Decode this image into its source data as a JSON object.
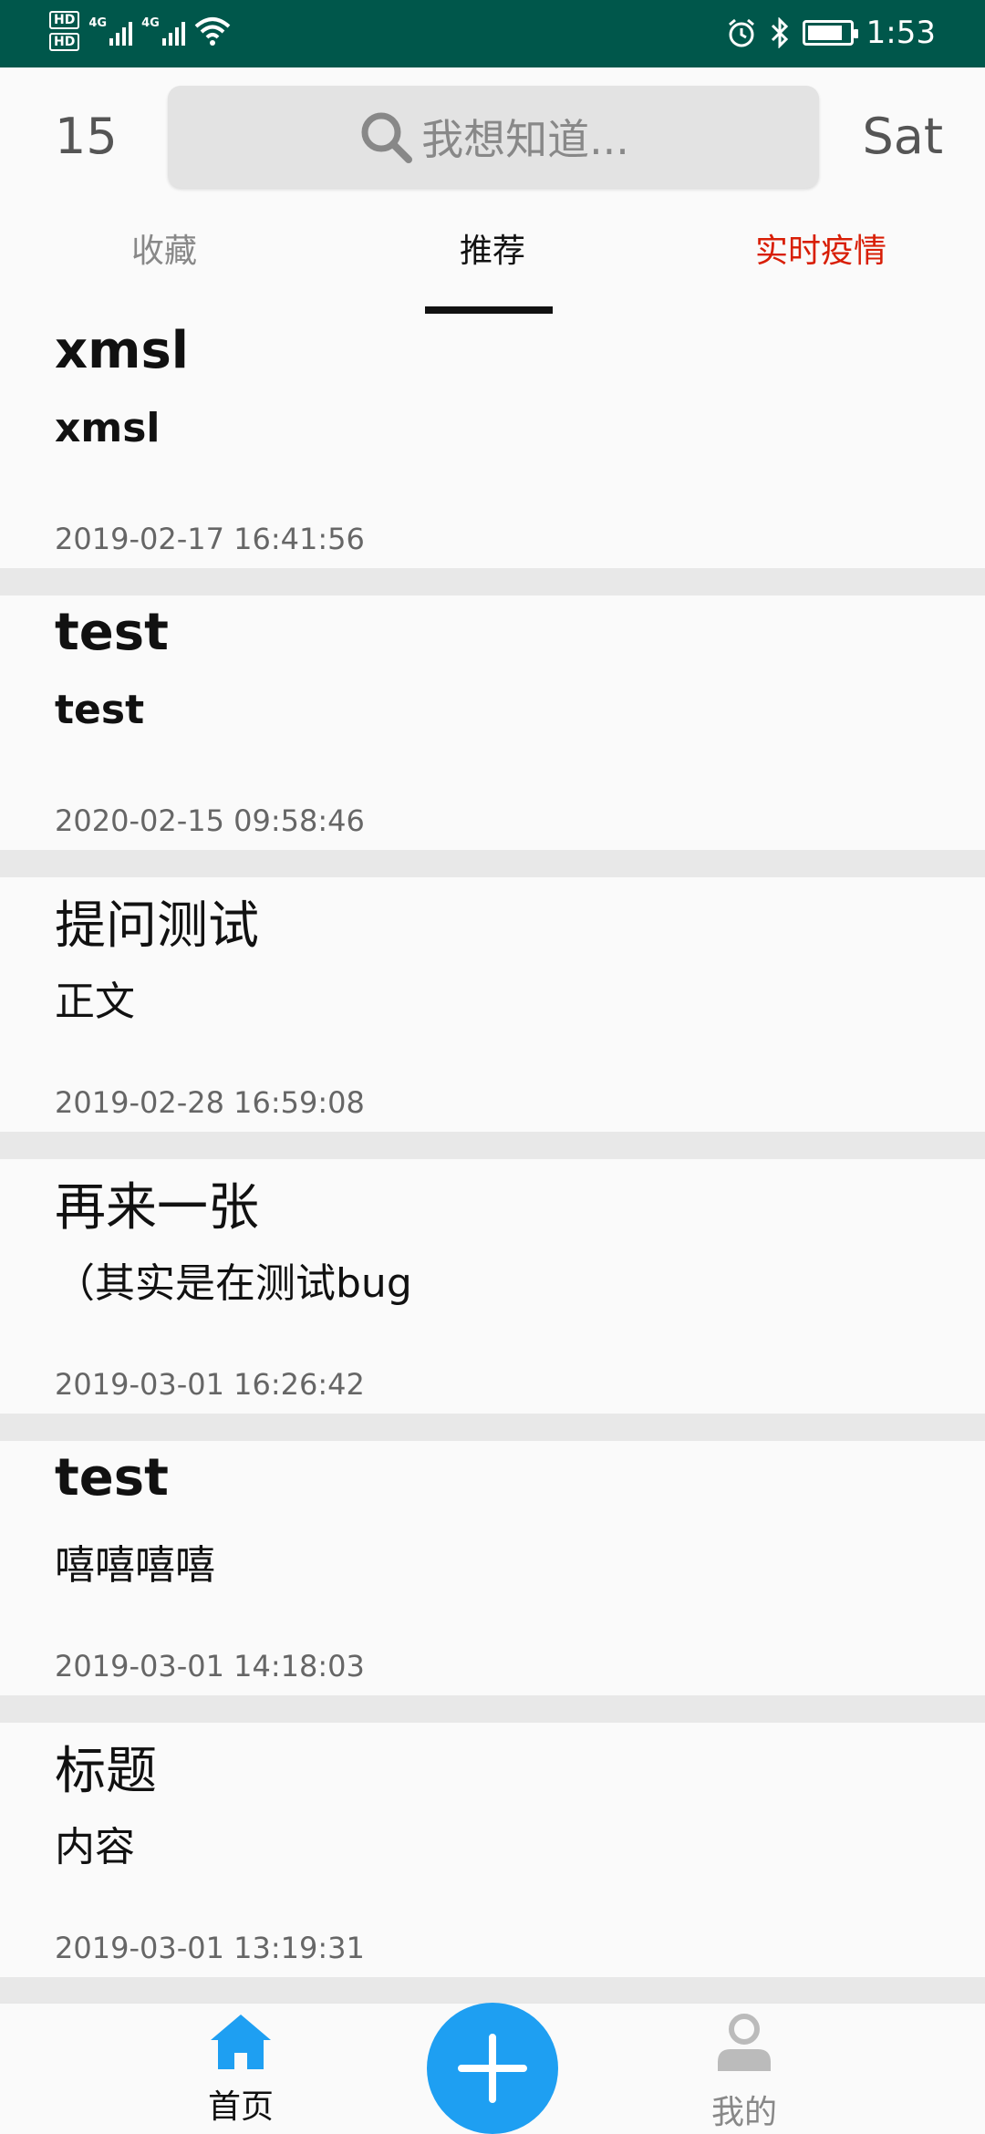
{
  "status_bar": {
    "time": "1:53",
    "network_labels": [
      "4G",
      "4G"
    ],
    "hd_labels": [
      "HD",
      "HD"
    ],
    "icons": [
      "hd-icon",
      "signal-icon",
      "wifi-icon",
      "alarm-icon",
      "bluetooth-icon",
      "battery-icon"
    ],
    "battery_level": 0.85
  },
  "header": {
    "day_number": "15",
    "day_name": "Sat",
    "search_placeholder": "我想知道..."
  },
  "tabs": [
    {
      "label": "收藏",
      "active": false
    },
    {
      "label": "推荐",
      "active": true
    },
    {
      "label": "实时疫情",
      "active": false,
      "color": "#d81e06"
    }
  ],
  "posts": [
    {
      "title": "xmsl",
      "body": "xmsl",
      "date": "2019-02-17 16:41:56"
    },
    {
      "title": "test",
      "body": "test",
      "date": "2020-02-15 09:58:46"
    },
    {
      "title": "提问测试",
      "body": "正文",
      "date": "2019-02-28 16:59:08"
    },
    {
      "title": "再来一张",
      "body": "（其实是在测试bug",
      "date": "2019-03-01 16:26:42"
    },
    {
      "title": "test",
      "body": "嘻嘻嘻嘻",
      "date": "2019-03-01 14:18:03"
    },
    {
      "title": "标题",
      "body": "内容",
      "date": "2019-03-01 13:19:31"
    }
  ],
  "bottom_nav": {
    "home_label": "首页",
    "me_label": "我的",
    "add_icon": "plus-icon"
  },
  "colors": {
    "status_bar": "#00574b",
    "accent": "#1e9ff2",
    "epidemic_tab": "#d81e06"
  }
}
